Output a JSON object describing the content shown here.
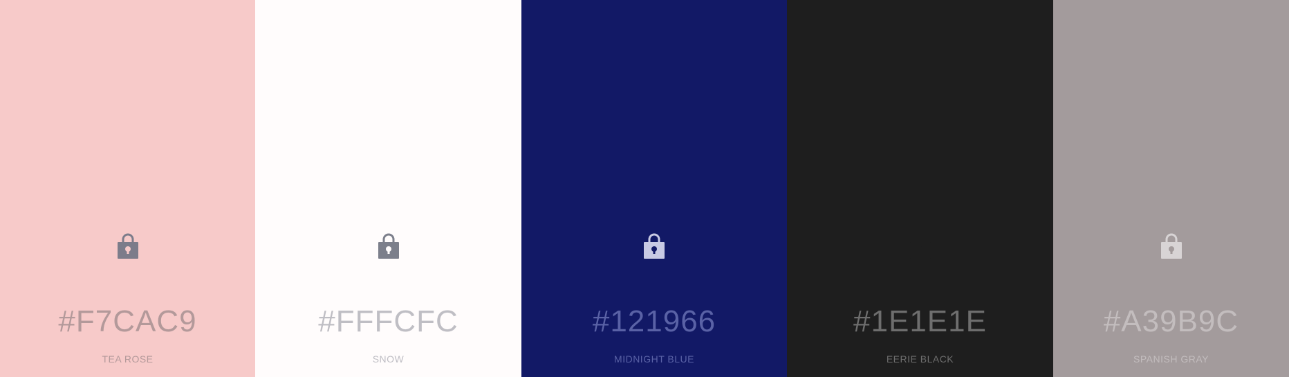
{
  "palette": {
    "swatches": [
      {
        "hex": "#F7CAC9",
        "name": "TEA ROSE",
        "background": "#F7CAC9",
        "text_color": "#B3999A",
        "lock_color": "#7C7C8A",
        "lock_icon": "lock-icon"
      },
      {
        "hex": "#FFFCFC",
        "name": "SNOW",
        "background": "#FFFCFC",
        "text_color": "#BFBEC4",
        "lock_color": "#7C7F8B",
        "lock_icon": "lock-icon"
      },
      {
        "hex": "#121966",
        "name": "MIDNIGHT BLUE",
        "background": "#121966",
        "text_color": "#5A62A6",
        "lock_color": "#C8CAE4",
        "lock_icon": "lock-icon"
      },
      {
        "hex": "#1E1E1E",
        "name": "EERIE BLACK",
        "background": "#1E1E1E",
        "text_color": "#6E6E6E",
        "lock_color": "#1E1E1E",
        "lock_icon": "lock-icon"
      },
      {
        "hex": "#A39B9C",
        "name": "SPANISH GRAY",
        "background": "#A39B9C",
        "text_color": "#C3BDBE",
        "lock_color": "#D8D4D5",
        "lock_icon": "lock-icon"
      }
    ]
  }
}
